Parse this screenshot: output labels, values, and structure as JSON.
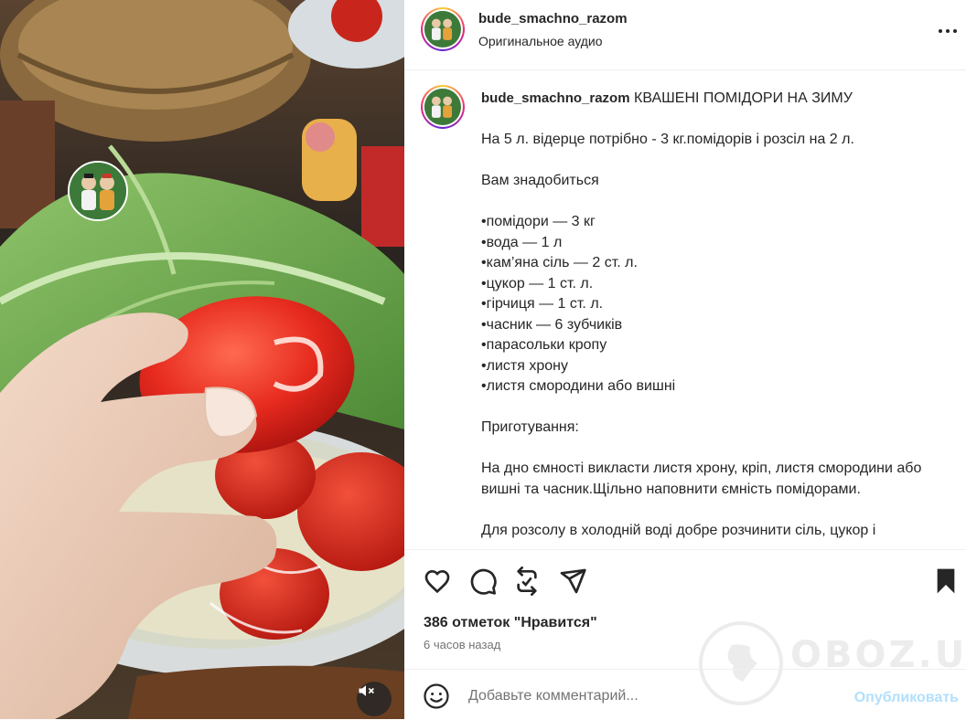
{
  "header": {
    "username": "bude_smachno_razom",
    "audio": "Оригинальное аудио"
  },
  "caption": {
    "username": "bude_smachno_razom",
    "title": "КВАШЕНІ ПОМІДОРИ НА ЗИМУ",
    "body": "На 5 л. відерце потрібно - 3 кг.помідорів і розсіл на 2 л.\n\nВам знадобиться\n\n•помідори — 3 кг\n•вода — 1 л\n•кам’яна сіль — 2 ст. л.\n•цукор — 1 ст. л.\n•гірчиця — 1 ст. л.\n•часник — 6 зубчиків\n•парасольки кропу\n•листя хрону\n•листя смородини або вишні\n\nПриготування:\n\nНа дно ємності викласти листя хрону, кріп, листя смородини або вишні та часник.Щільно наповнити ємність помідорами.\n\nДля розсолу в холодній воді добре розчинити сіль, цукор і"
  },
  "actions": {
    "like_icon": "heart-icon",
    "comment_icon": "comment-icon",
    "repost_icon": "repost-icon",
    "share_icon": "share-icon",
    "save_icon": "bookmark-icon"
  },
  "likes_text": "386 отметок \"Нравится\"",
  "time_text": "6 часов назад",
  "comment": {
    "placeholder": "Добавьте комментарий...",
    "publish_label": "Опубликовать"
  },
  "watermark": "OBOZ.UA",
  "colors": {
    "accent_publish": "#b2dffc",
    "text_primary": "#262626",
    "text_secondary": "#737373"
  }
}
